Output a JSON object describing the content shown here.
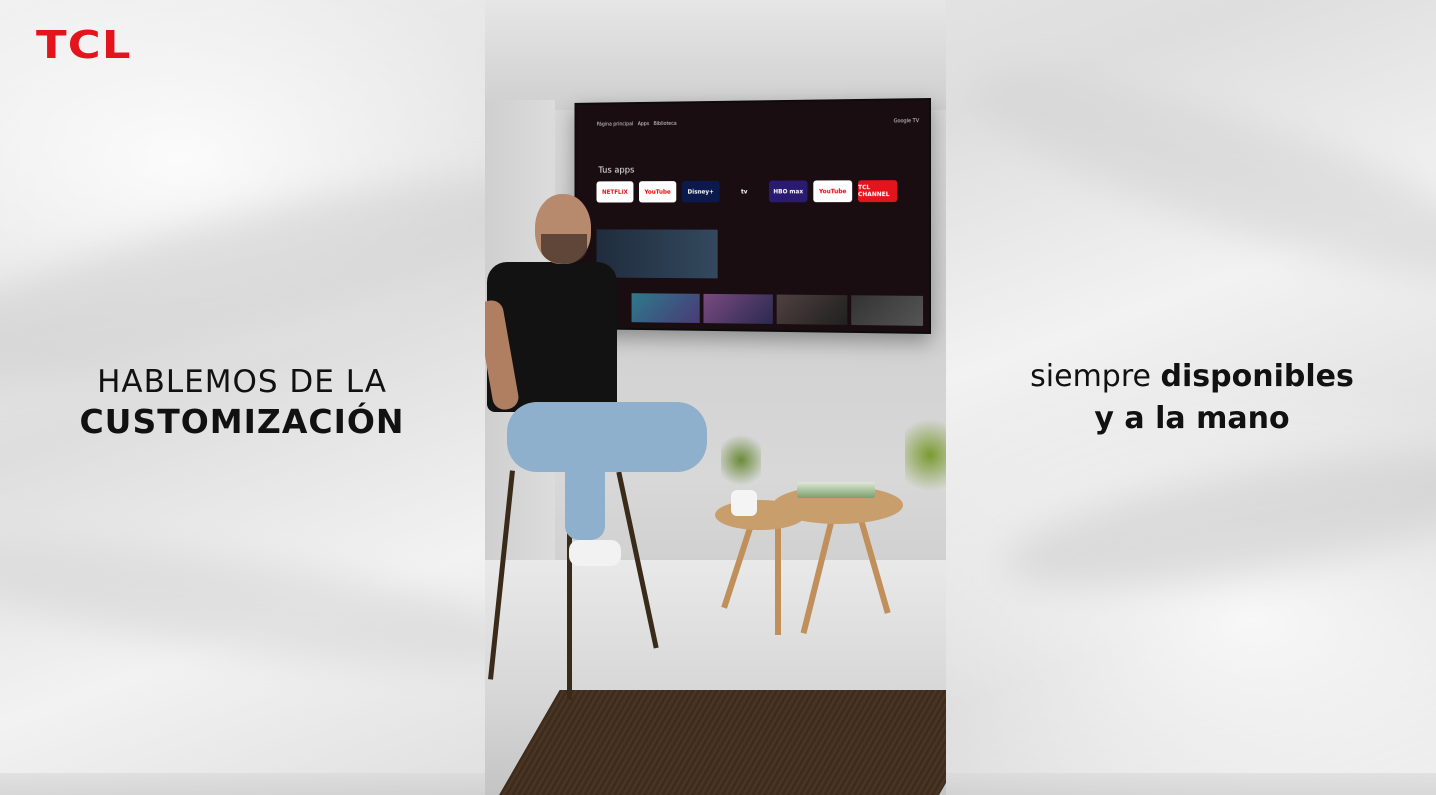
{
  "brand": {
    "logo_text": "TCL",
    "color": "#e4141c"
  },
  "left_caption": {
    "line1": "HABLEMOS DE LA",
    "line2": "CUSTOMIZACIÓN"
  },
  "right_caption": {
    "word1": "siempre",
    "word2": "disponibles",
    "line2": "y a la mano"
  },
  "tv_screen": {
    "nav_items": [
      "Página principal",
      "Apps",
      "Biblioteca"
    ],
    "account_label": "Google TV",
    "section_label": "Tus apps",
    "apps": [
      "NETFLIX",
      "YouTube",
      "Disney+",
      "tv",
      "HBO max",
      "YouTube",
      "TCL CHANNEL"
    ]
  }
}
